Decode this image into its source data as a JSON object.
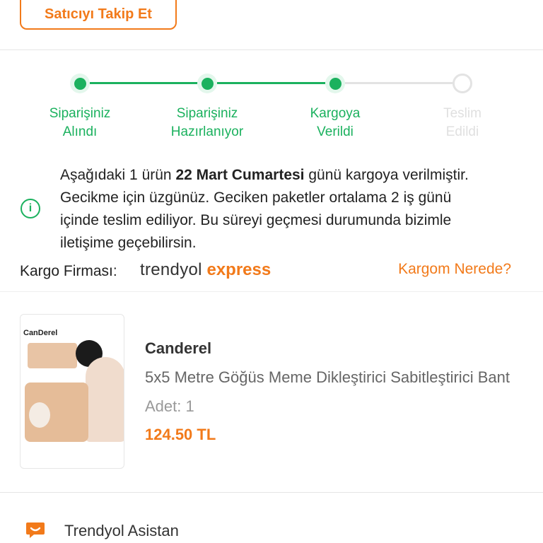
{
  "seller": {
    "follow_label": "Satıcıyı Takip Et"
  },
  "steps": [
    {
      "line1": "Siparişiniz",
      "line2": "Alındı",
      "state": "done"
    },
    {
      "line1": "Siparişiniz",
      "line2": "Hazırlanıyor",
      "state": "done"
    },
    {
      "line1": "Kargoya",
      "line2": "Verildi",
      "state": "done"
    },
    {
      "line1": "Teslim",
      "line2": "Edildi",
      "state": "todo"
    }
  ],
  "info": {
    "part1": "Aşağıdaki 1 ürün ",
    "bold": "22 Mart Cumartesi",
    "part2": " günü kargoya verilmiştir. Gecikme için üzgünüz. Geciken paketler ortalama 2 iş günü içinde teslim ediliyor. Bu süreyi geçmesi durumunda bizimle iletişime geçebilirsin."
  },
  "cargo": {
    "label": "Kargo Firması:",
    "logo_part1": "trendyol",
    "logo_part2": "express",
    "track_label": "Kargom Nerede?"
  },
  "product": {
    "image_brand": "CanDerel",
    "brand": "Canderel",
    "name": "5x5 Metre Göğüs Meme Dikleştirici Sabitleştirici Bant",
    "qty_label": "Adet:",
    "qty_value": "1",
    "price": "124.50 TL"
  },
  "assistant": {
    "label": "Trendyol Asistan"
  },
  "colors": {
    "accent": "#f27a1a",
    "success": "#1bb15e",
    "inactive": "#e3e3e3"
  },
  "icons": {
    "info": "info-circle-icon",
    "assistant": "chat-bubble-icon"
  }
}
